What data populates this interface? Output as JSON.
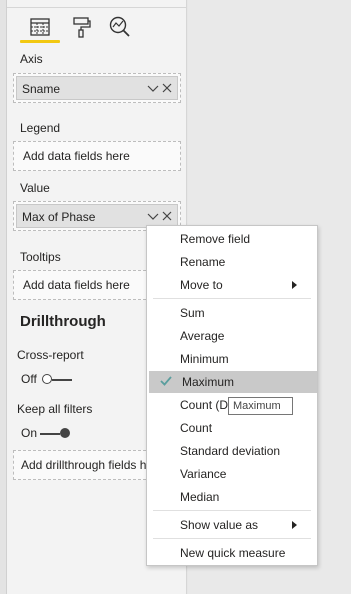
{
  "tabs": [
    {
      "name": "fields-tab",
      "icon": "table-fields-icon"
    },
    {
      "name": "format-tab",
      "icon": "paint-roller-icon"
    },
    {
      "name": "analytics-tab",
      "icon": "analytics-magnifier-icon"
    }
  ],
  "accent_color": "#f2c811",
  "wells": {
    "axis": {
      "label": "Axis",
      "field": "Sname"
    },
    "legend": {
      "label": "Legend",
      "placeholder": "Add data fields here"
    },
    "value": {
      "label": "Value",
      "field": "Max of Phase"
    },
    "tooltips": {
      "label": "Tooltips",
      "placeholder": "Add data fields here"
    }
  },
  "drillthrough": {
    "title": "Drillthrough",
    "cross_report": {
      "label": "Cross-report",
      "state": "Off"
    },
    "keep_all_filters": {
      "label": "Keep all filters",
      "state": "On"
    },
    "placeholder": "Add drillthrough fields h"
  },
  "context_menu": {
    "remove_field": "Remove field",
    "rename": "Rename",
    "move_to": "Move to",
    "sum": "Sum",
    "average": "Average",
    "minimum": "Minimum",
    "maximum": "Maximum",
    "count_distinct": "Count (D",
    "count": "Count",
    "standard_deviation": "Standard deviation",
    "variance": "Variance",
    "median": "Median",
    "show_value_as": "Show value as",
    "new_quick_measure": "New quick measure"
  },
  "tooltip": "Maximum"
}
